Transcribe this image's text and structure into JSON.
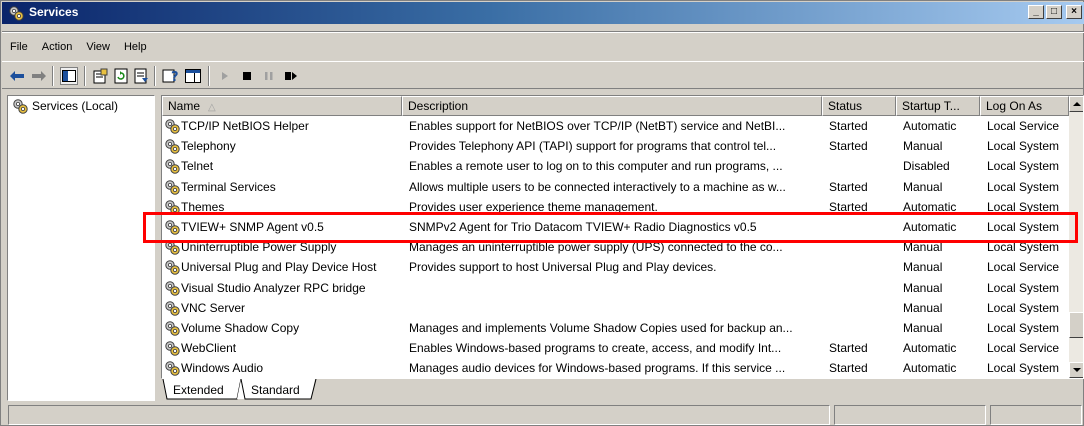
{
  "window": {
    "title": "Services"
  },
  "menu": [
    "File",
    "Action",
    "View",
    "Help"
  ],
  "tree": {
    "root_label": "Services (Local)"
  },
  "columns": {
    "name": "Name",
    "description": "Description",
    "status": "Status",
    "startup": "Startup T...",
    "logon": "Log On As"
  },
  "services": [
    {
      "name": "TCP/IP NetBIOS Helper",
      "description": "Enables support for NetBIOS over TCP/IP (NetBT) service and NetBI...",
      "status": "Started",
      "startup": "Automatic",
      "logon": "Local Service"
    },
    {
      "name": "Telephony",
      "description": "Provides Telephony API (TAPI) support for programs that control tel...",
      "status": "Started",
      "startup": "Manual",
      "logon": "Local System"
    },
    {
      "name": "Telnet",
      "description": "Enables a remote user to log on to this computer and run programs, ...",
      "status": "",
      "startup": "Disabled",
      "logon": "Local System"
    },
    {
      "name": "Terminal Services",
      "description": "Allows multiple users to be connected interactively to a machine as w...",
      "status": "Started",
      "startup": "Manual",
      "logon": "Local System"
    },
    {
      "name": "Themes",
      "description": "Provides user experience theme management.",
      "status": "Started",
      "startup": "Automatic",
      "logon": "Local System"
    },
    {
      "name": "TVIEW+ SNMP Agent v0.5",
      "description": "SNMPv2 Agent for Trio Datacom TVIEW+ Radio Diagnostics v0.5",
      "status": "",
      "startup": "Automatic",
      "logon": "Local System"
    },
    {
      "name": "Uninterruptible Power Supply",
      "description": "Manages an uninterruptible power supply (UPS) connected to the co...",
      "status": "",
      "startup": "Manual",
      "logon": "Local System"
    },
    {
      "name": "Universal Plug and Play Device Host",
      "description": "Provides support to host Universal Plug and Play devices.",
      "status": "",
      "startup": "Manual",
      "logon": "Local Service"
    },
    {
      "name": "Visual Studio Analyzer RPC bridge",
      "description": "",
      "status": "",
      "startup": "Manual",
      "logon": "Local System"
    },
    {
      "name": "VNC Server",
      "description": "",
      "status": "",
      "startup": "Manual",
      "logon": "Local System"
    },
    {
      "name": "Volume Shadow Copy",
      "description": "Manages and implements Volume Shadow Copies used for backup an...",
      "status": "",
      "startup": "Manual",
      "logon": "Local System"
    },
    {
      "name": "WebClient",
      "description": "Enables Windows-based programs to create, access, and modify Int...",
      "status": "Started",
      "startup": "Automatic",
      "logon": "Local Service"
    },
    {
      "name": "Windows Audio",
      "description": "Manages audio devices for Windows-based programs. If this service ...",
      "status": "Started",
      "startup": "Automatic",
      "logon": "Local System"
    }
  ],
  "tabs": [
    "Extended",
    "Standard"
  ],
  "colors": {
    "highlight": "#ff0000",
    "title_start": "#0a246a",
    "title_end": "#a6caf0"
  }
}
